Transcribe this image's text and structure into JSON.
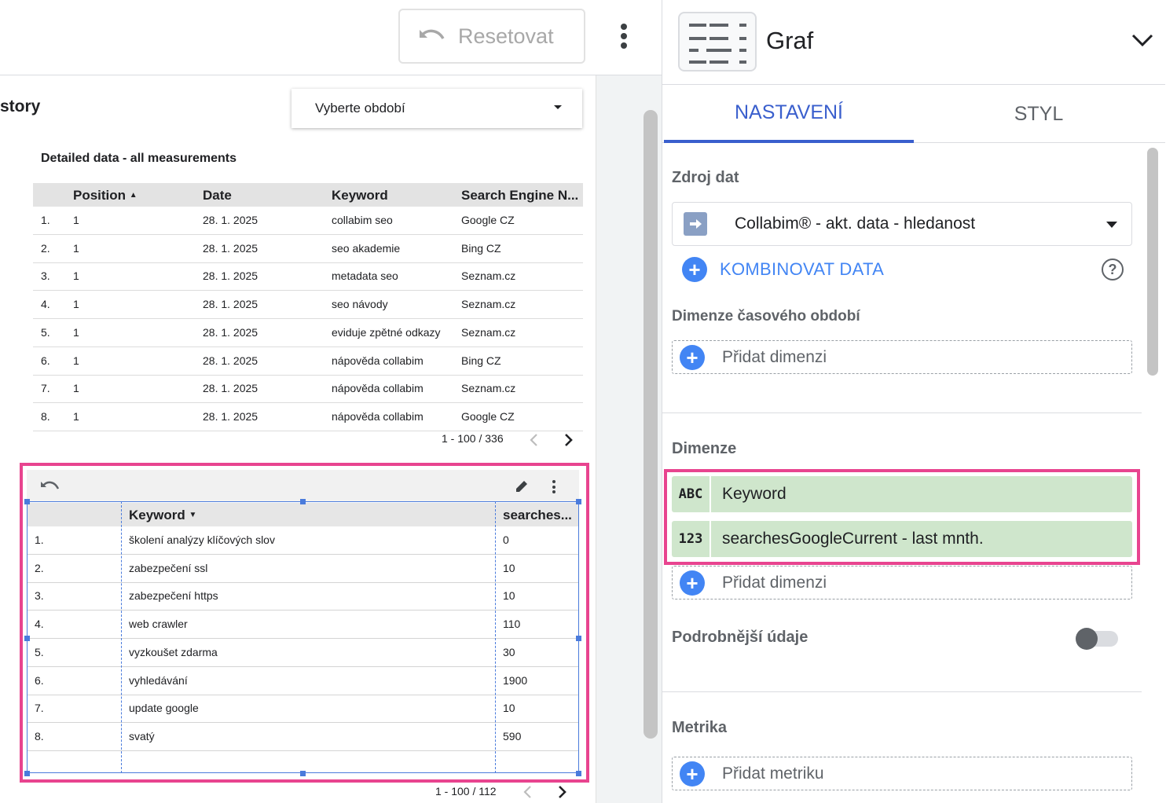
{
  "toolbar": {
    "reset_label": "Resetovat"
  },
  "canvas": {
    "page_heading": "story",
    "period_select_label": "Vyberte období",
    "table1": {
      "title": "Detailed data - all measurements",
      "columns": [
        "Position",
        "Date",
        "Keyword",
        "Search Engine N..."
      ],
      "sort_indicator": "▲",
      "rows": [
        {
          "idx": "1.",
          "position": "1",
          "date": "28. 1. 2025",
          "keyword": "collabim seo",
          "engine": "Google CZ"
        },
        {
          "idx": "2.",
          "position": "1",
          "date": "28. 1. 2025",
          "keyword": "seo akademie",
          "engine": "Bing CZ"
        },
        {
          "idx": "3.",
          "position": "1",
          "date": "28. 1. 2025",
          "keyword": "metadata seo",
          "engine": "Seznam.cz"
        },
        {
          "idx": "4.",
          "position": "1",
          "date": "28. 1. 2025",
          "keyword": "seo návody",
          "engine": "Seznam.cz"
        },
        {
          "idx": "5.",
          "position": "1",
          "date": "28. 1. 2025",
          "keyword": "eviduje zpětné odkazy",
          "engine": "Seznam.cz"
        },
        {
          "idx": "6.",
          "position": "1",
          "date": "28. 1. 2025",
          "keyword": "nápověda collabim",
          "engine": "Bing CZ"
        },
        {
          "idx": "7.",
          "position": "1",
          "date": "28. 1. 2025",
          "keyword": "nápověda collabim",
          "engine": "Seznam.cz"
        },
        {
          "idx": "8.",
          "position": "1",
          "date": "28. 1. 2025",
          "keyword": "nápověda collabim",
          "engine": "Google CZ"
        }
      ],
      "pager": "1 - 100 / 336"
    },
    "table2": {
      "columns": [
        "Keyword",
        "searches..."
      ],
      "sort_indicator": "▼",
      "rows": [
        {
          "idx": "1.",
          "keyword": "školení analýzy klíčových slov",
          "value": "0"
        },
        {
          "idx": "2.",
          "keyword": "zabezpečení ssl",
          "value": "10"
        },
        {
          "idx": "3.",
          "keyword": "zabezpečení https",
          "value": "10"
        },
        {
          "idx": "4.",
          "keyword": "web crawler",
          "value": "110"
        },
        {
          "idx": "5.",
          "keyword": "vyzkoušet zdarma",
          "value": "30"
        },
        {
          "idx": "6.",
          "keyword": "vyhledávání",
          "value": "1900"
        },
        {
          "idx": "7.",
          "keyword": "update google",
          "value": "10"
        },
        {
          "idx": "8.",
          "keyword": "svatý",
          "value": "590"
        }
      ],
      "pager": "1 - 100 / 112"
    }
  },
  "panel": {
    "chart_type": "Graf",
    "tabs": [
      {
        "label": "NASTAVENÍ",
        "active": true
      },
      {
        "label": "STYL",
        "active": false
      }
    ],
    "data_source": {
      "label": "Zdroj dat",
      "value": "Collabim® - akt. data - hledanost",
      "blend_label": "KOMBINOVAT DATA",
      "help": "?"
    },
    "date_range_dimension": {
      "label": "Dimenze časového období",
      "add_label": "Přidat dimenzi"
    },
    "dimensions": {
      "label": "Dimenze",
      "items": [
        {
          "type": "ABC",
          "name": "Keyword"
        },
        {
          "type": "123",
          "name": "searchesGoogleCurrent - last mnth."
        }
      ],
      "add_label": "Přidat dimenzi"
    },
    "drill_down": {
      "label": "Podrobnější údaje",
      "enabled": false
    },
    "metrics": {
      "label": "Metrika",
      "add_label": "Přidat metriku"
    }
  },
  "colors": {
    "accent": "#3a5fcd",
    "plus": "#4285f4",
    "selection": "#e8448f",
    "chip": "#cfe6cc",
    "handle": "#4a7bdc"
  }
}
